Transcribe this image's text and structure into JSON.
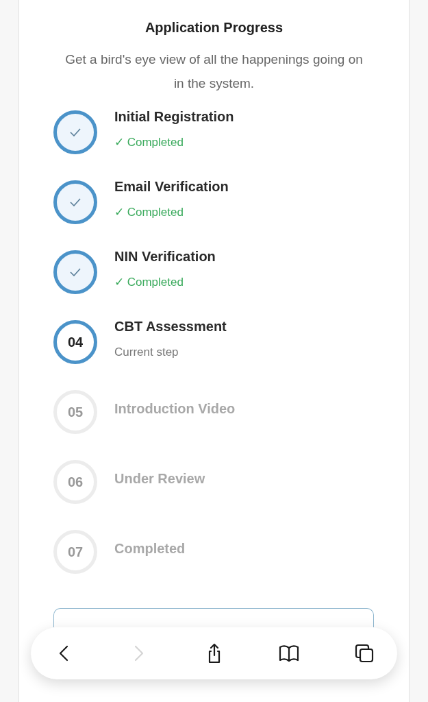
{
  "card": {
    "title": "Application Progress",
    "subtitle": "Get a bird's eye view of all the happenings going on in the system.",
    "steps": [
      {
        "kind": "done",
        "label": "Initial Registration",
        "note": "✓ Completed"
      },
      {
        "kind": "done",
        "label": "Email Verification",
        "note": "✓ Completed"
      },
      {
        "kind": "done",
        "label": "NIN Verification",
        "note": "✓ Completed"
      },
      {
        "kind": "current",
        "number": "04",
        "label": "CBT Assessment",
        "note": "Current step"
      },
      {
        "kind": "pending",
        "number": "05",
        "label": "Introduction Video"
      },
      {
        "kind": "pending",
        "number": "06",
        "label": "Under Review"
      },
      {
        "kind": "pending",
        "number": "07",
        "label": "Completed"
      }
    ]
  },
  "browser_toolbar": [
    {
      "kind": "back",
      "disabled": false
    },
    {
      "kind": "forward",
      "disabled": true
    },
    {
      "kind": "share",
      "disabled": false
    },
    {
      "kind": "bookmarks",
      "disabled": false
    },
    {
      "kind": "tabs",
      "disabled": false
    }
  ]
}
